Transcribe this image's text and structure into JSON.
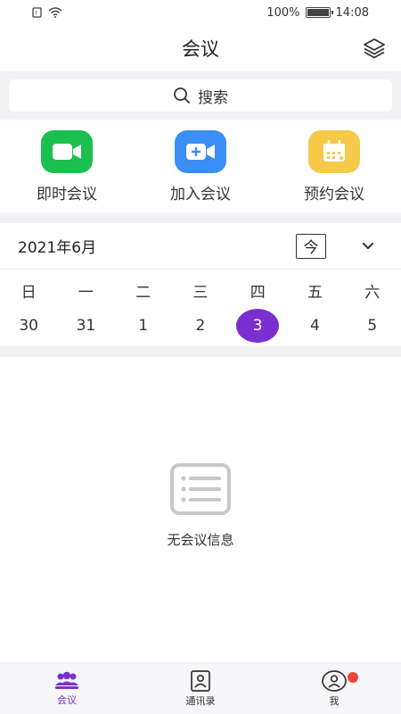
{
  "status_bar": {
    "battery": "100%",
    "time": "14:08"
  },
  "header": {
    "title": "会议"
  },
  "search": {
    "label": "搜索"
  },
  "actions": [
    {
      "label": "即时会议",
      "icon": "video-camera-icon",
      "color": "#1bbf4e"
    },
    {
      "label": "加入会议",
      "icon": "join-camera-icon",
      "color": "#3a8ef6"
    },
    {
      "label": "预约会议",
      "icon": "calendar-icon",
      "color": "#f6c94a"
    }
  ],
  "calendar": {
    "month": "2021年6月",
    "today_label": "今",
    "weekdays": [
      "日",
      "一",
      "二",
      "三",
      "四",
      "五",
      "六"
    ],
    "dates": [
      "30",
      "31",
      "1",
      "2",
      "3",
      "4",
      "5"
    ],
    "selected": "3",
    "accent": "#7b2fd0"
  },
  "empty_state": {
    "text": "无会议信息"
  },
  "tabs": [
    {
      "label": "会议",
      "active": true
    },
    {
      "label": "通讯录",
      "active": false
    },
    {
      "label": "我",
      "active": false
    }
  ]
}
